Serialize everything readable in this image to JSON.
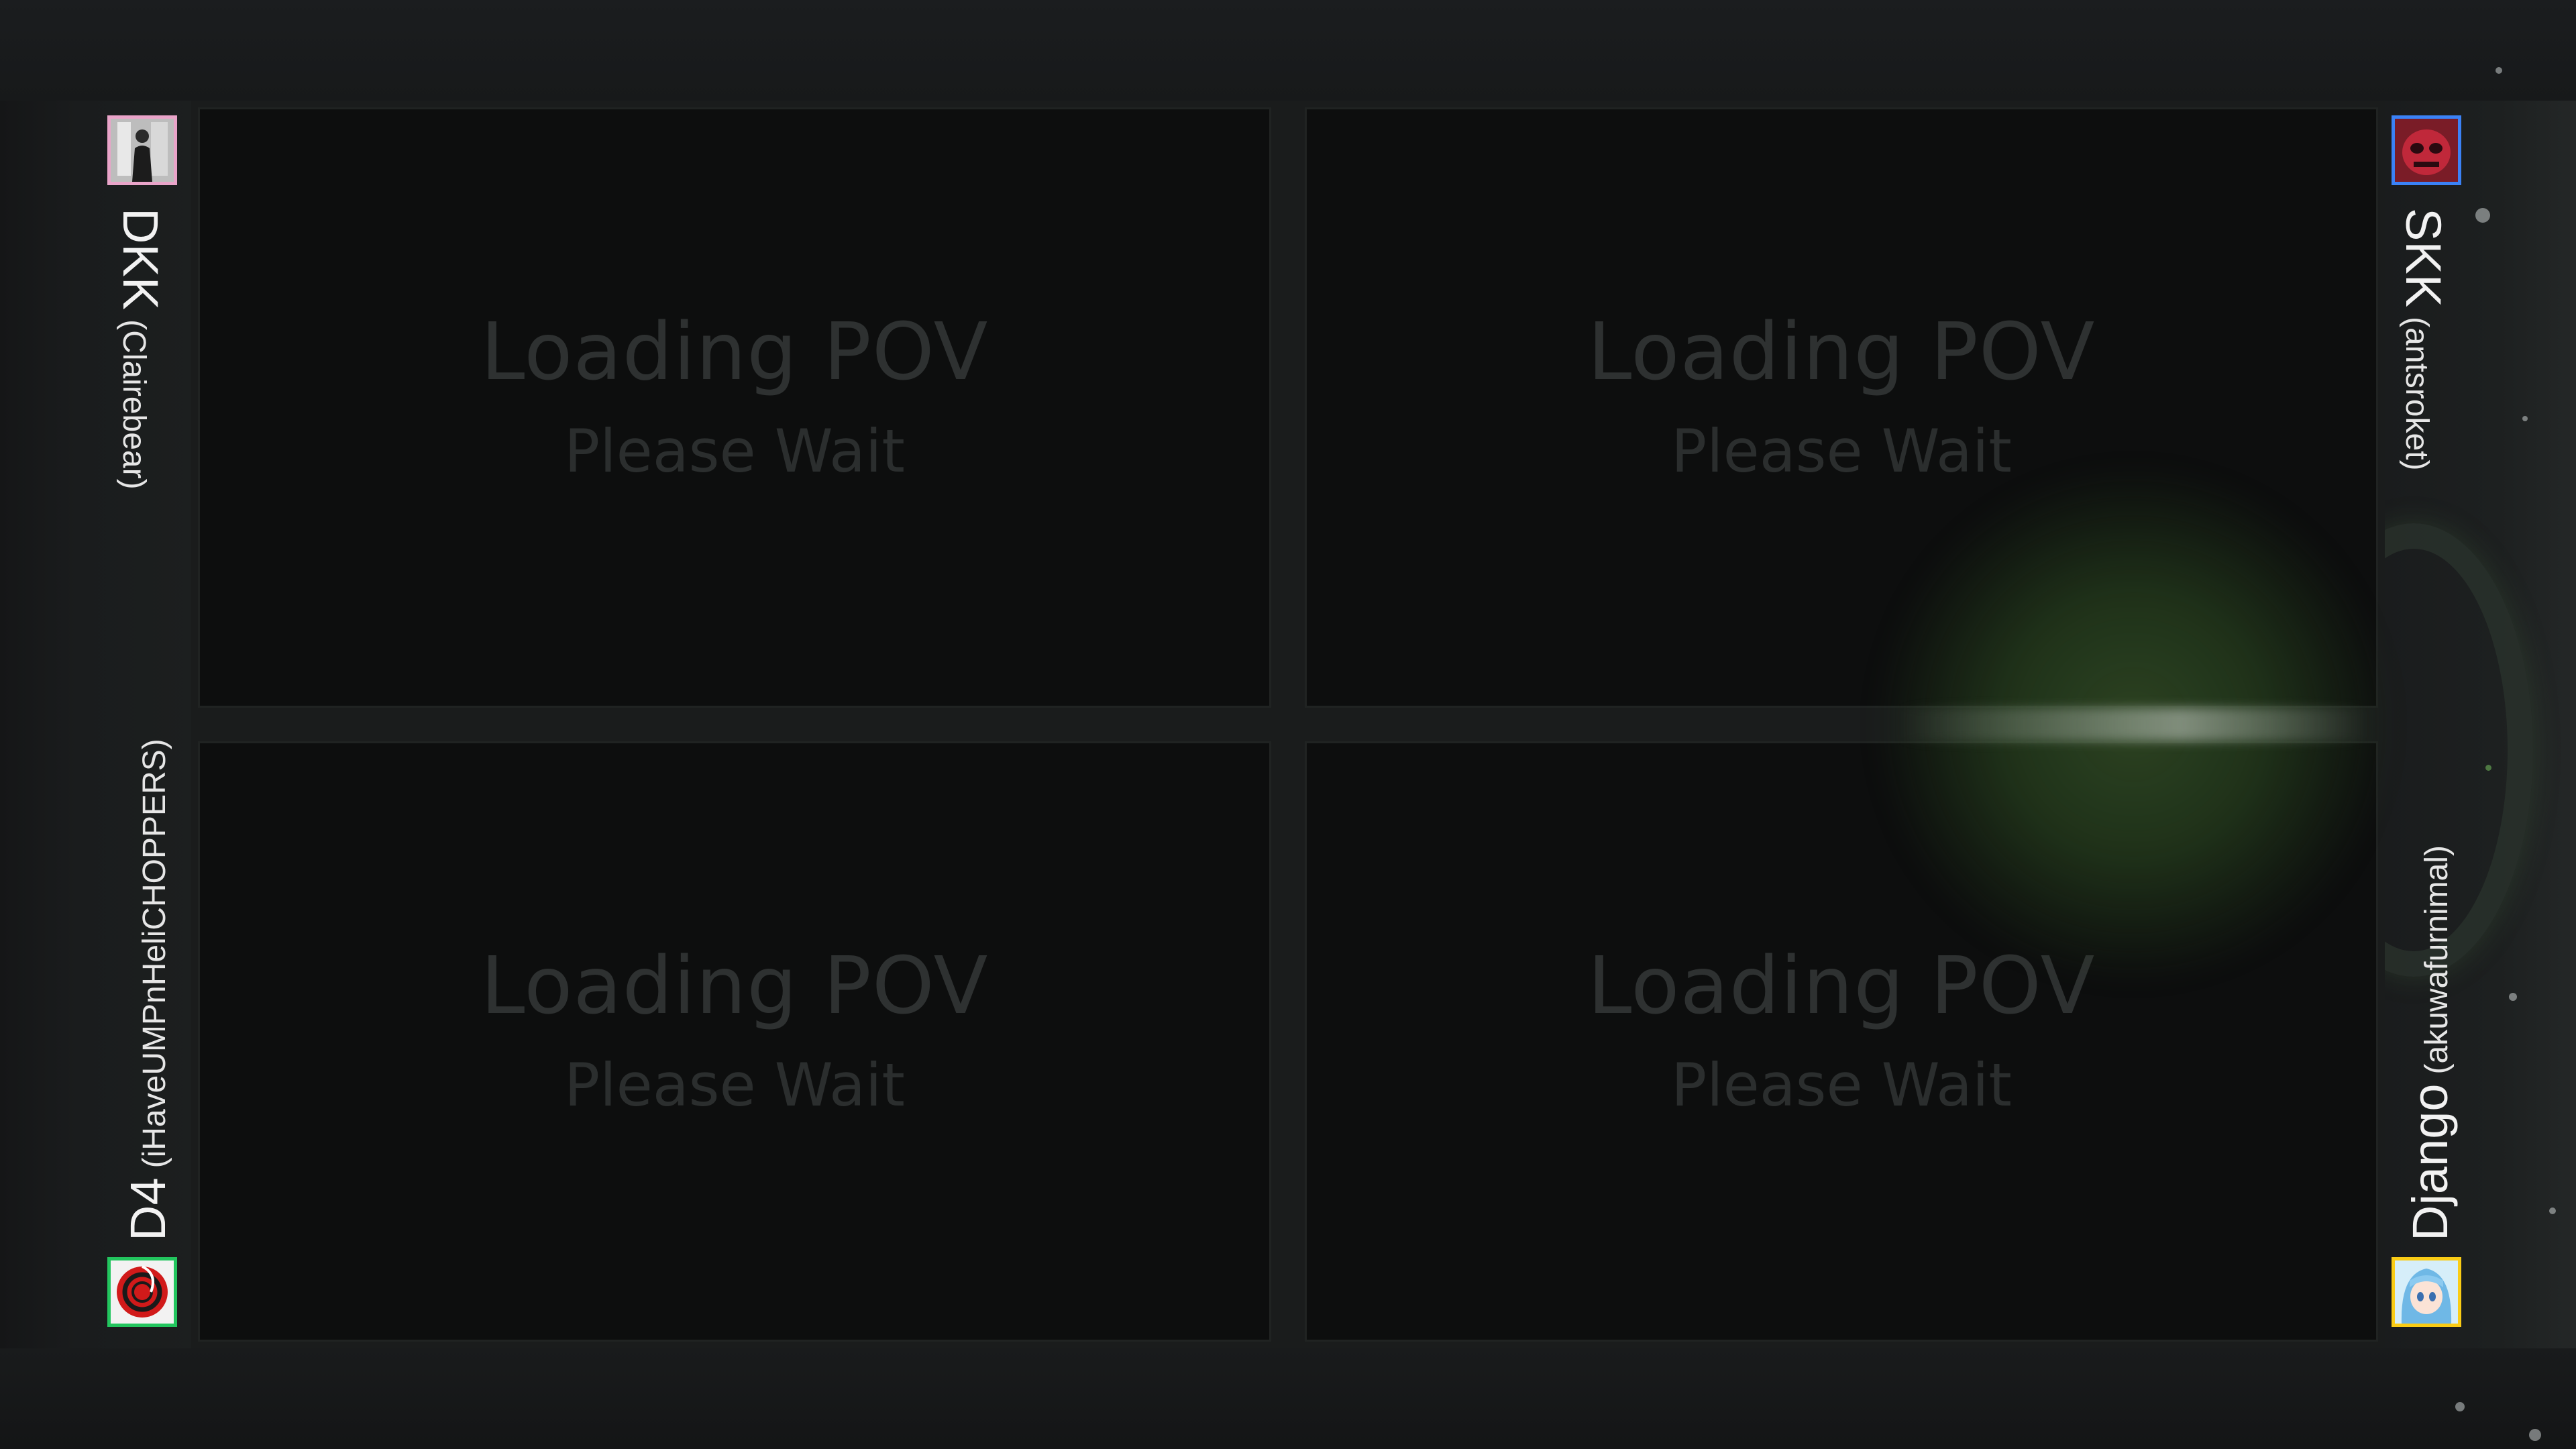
{
  "povs": [
    {
      "title": "Loading POV",
      "subtitle": "Please Wait"
    },
    {
      "title": "Loading POV",
      "subtitle": "Please Wait"
    },
    {
      "title": "Loading POV",
      "subtitle": "Please Wait"
    },
    {
      "title": "Loading POV",
      "subtitle": "Please Wait"
    }
  ],
  "players": {
    "top_left": {
      "tag": "DKK",
      "handle": "(Clairebear)",
      "accent": "#e9a4c9",
      "avatar_icon": "person-photo-icon"
    },
    "bottom_left": {
      "tag": "D4",
      "handle": "(iHaveUMPnHeliCHOPPERS)",
      "accent": "#22c55e",
      "avatar_icon": "red-spiral-logo-icon"
    },
    "top_right": {
      "tag": "SKK",
      "handle": "(antsroket)",
      "accent": "#3b82f6",
      "avatar_icon": "red-mask-icon"
    },
    "bottom_right": {
      "tag": "Django",
      "handle": "(akuwafurnimal)",
      "accent": "#facc15",
      "avatar_icon": "anime-girl-icon"
    }
  },
  "colors": {
    "background": "#111214",
    "pov_panel": "#0d0e0e",
    "loading_text": "#2e3131",
    "glow": "#4a7a35"
  }
}
